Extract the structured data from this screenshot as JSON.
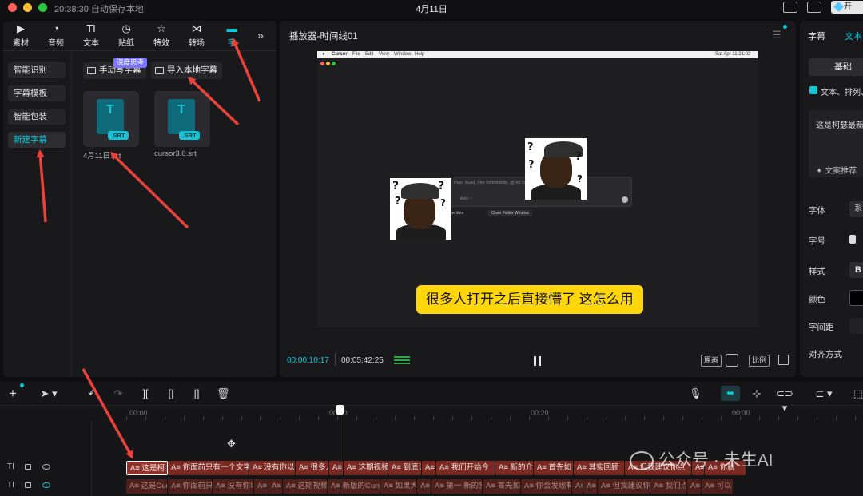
{
  "topbar": {
    "autosave": "20:38:30 自动保存本地",
    "date": "4月11日",
    "pro_badge": "开"
  },
  "media_tabs": [
    {
      "label": "素材",
      "icon": "media-icon"
    },
    {
      "label": "音频",
      "icon": "audio-icon"
    },
    {
      "label": "文本",
      "icon": "text-icon"
    },
    {
      "label": "贴纸",
      "icon": "sticker-icon"
    },
    {
      "label": "特效",
      "icon": "effects-icon"
    },
    {
      "label": "转场",
      "icon": "transition-icon"
    },
    {
      "label": "字",
      "icon": "caption-icon"
    }
  ],
  "sidenav": [
    "智能识别",
    "字幕模板",
    "智能包装",
    "新建字幕"
  ],
  "caption_actions": {
    "manual": "手动写字幕",
    "import": "导入本地字幕",
    "badge": "深度思考"
  },
  "files": [
    {
      "name": "4月11日.srt",
      "ext": ".SRT",
      "glyph": "T"
    },
    {
      "name": "cursor3.0.srt",
      "ext": ".SRT",
      "glyph": "T"
    }
  ],
  "player": {
    "title": "播放器-时间线01",
    "subtitle": "很多人打开之后直接懵了 这怎么用",
    "current_time": "00:00:10:17",
    "duration": "00:05:42:25",
    "btn_original": "原画",
    "btn_ratio": "比例",
    "screen": {
      "menu": [
        "Cursor",
        "File",
        "Edit",
        "View",
        "Window",
        "Help"
      ],
      "clock": "Sat Apr 11 21:02",
      "prompt": "Plan, Build, / for commands, @ for context",
      "ask": "Auto ~",
      "new_idea": "New Idea",
      "open_folder": "Open Folder Window"
    }
  },
  "inspector": {
    "tab1": "字幕",
    "tab2": "文本",
    "basic": "基础",
    "checkbox_label": "文本、排列、",
    "text_value": "这是柯瑟最新",
    "ai_recommend": "文案推荐",
    "rows": {
      "font": "字体",
      "size": "字号",
      "style": "样式",
      "color": "颜色",
      "spacing": "字间距",
      "align": "对齐方式"
    },
    "font_value": "系",
    "style_value": "B"
  },
  "timeline": {
    "ruler": [
      "00:00",
      "00:10",
      "00:20",
      "00:30"
    ],
    "track1_clips": [
      "这是柯",
      "你面前只有一个文字",
      "没有你以",
      "很多人打",
      "我",
      "这期视频",
      "到底该怎",
      "我",
      "我们开始今",
      "新的介",
      "首先如",
      "其实回顾",
      "但我建议你点",
      "我",
      "你就"
    ],
    "track2_clips": [
      "这是Cur",
      "你面前只",
      "没有你以",
      "我",
      "这",
      "这期视频",
      "新版的Curs",
      "如果大",
      "我",
      "第一 新的界",
      "首先如",
      "你会发现有",
      "A",
      "不",
      "但我建议你去",
      "我们点",
      "我",
      "可以"
    ],
    "track_label": "TI"
  },
  "watermark": "公众号 · 未生AI"
}
